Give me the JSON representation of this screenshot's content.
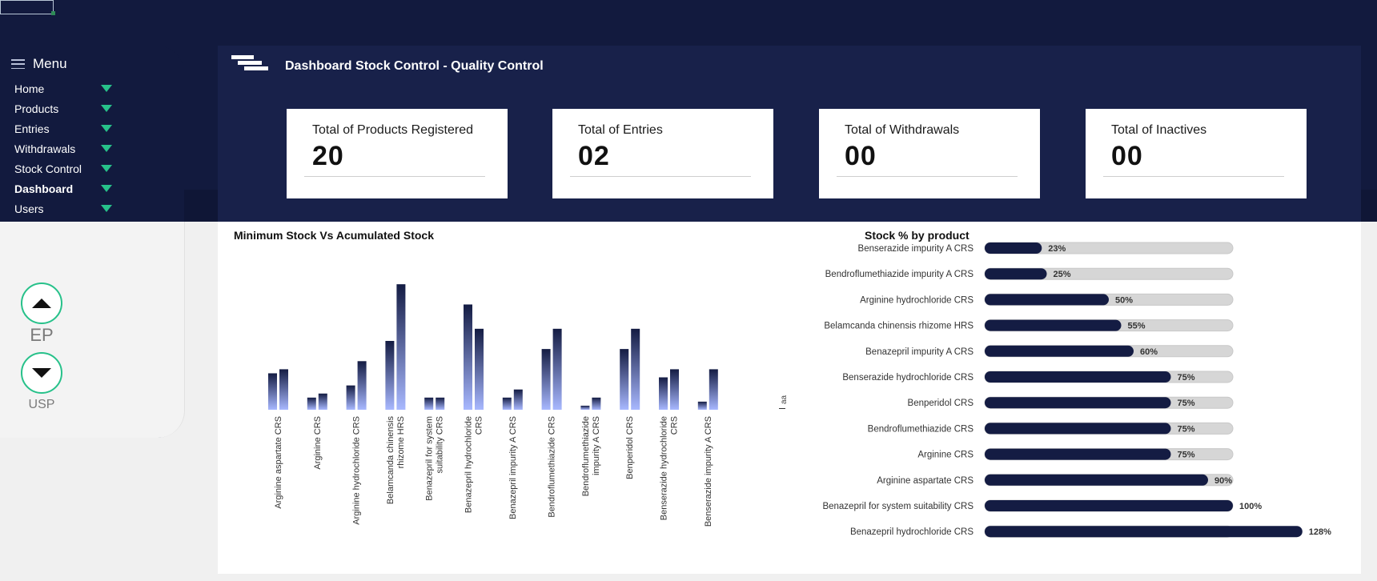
{
  "menu": {
    "title": "Menu",
    "items": [
      {
        "label": "Home",
        "active": false
      },
      {
        "label": "Products",
        "active": false
      },
      {
        "label": "Entries",
        "active": false
      },
      {
        "label": "Withdrawals",
        "active": false
      },
      {
        "label": "Stock Control",
        "active": false
      },
      {
        "label": "Dashboard",
        "active": true
      },
      {
        "label": "Users",
        "active": false
      }
    ]
  },
  "pharmacopeia": {
    "up_label": "EP",
    "down_label": "USP"
  },
  "header": {
    "title": "Dashboard Stock Control - Quality Control"
  },
  "kpis": [
    {
      "label": "Total of Products Registered",
      "value": "20"
    },
    {
      "label": "Total of Entries",
      "value": "02"
    },
    {
      "label": "Total of Withdrawals",
      "value": "00"
    },
    {
      "label": "Total of Inactives",
      "value": "00"
    }
  ],
  "colors": {
    "navy": "#121a3e",
    "accent": "#27c18a",
    "bar_dark": "#141c43",
    "bar_track": "#d6d6d6",
    "bar_light": "#a8b8ff"
  },
  "chart_data": [
    {
      "type": "bar",
      "title": "Minimum Stock Vs Acumulated Stock",
      "categories": [
        "Arginine aspartate CRS",
        "Arginine CRS",
        "Arginine hydrochloride CRS",
        "Belamcanda chinensis rhizome HRS",
        "Benazepril for system suitability CRS",
        "Benazepril hydrochloride CRS",
        "Benazepril impurity A CRS",
        "Bendroflumethiazide CRS",
        "Bendroflumethiazide impurity A CRS",
        "Benperidol CRS",
        "Benserazide hydrochloride CRS",
        "Benserazide impurity A CRS"
      ],
      "series": [
        {
          "values": [
            9,
            3,
            6,
            17,
            3,
            26,
            3,
            15,
            1,
            15,
            8,
            2
          ]
        },
        {
          "values": [
            10,
            4,
            12,
            31,
            3,
            20,
            5,
            20,
            3,
            20,
            10,
            10
          ]
        }
      ],
      "ylim": [
        0,
        34
      ],
      "y_axis_label": "aa"
    },
    {
      "type": "bar",
      "orientation": "horizontal",
      "title": "Stock % by product",
      "categories": [
        "Benserazide impurity A CRS",
        "Bendroflumethiazide impurity A CRS",
        "Arginine hydrochloride CRS",
        "Belamcanda chinensis rhizome HRS",
        "Benazepril impurity A CRS",
        "Benserazide hydrochloride CRS",
        "Benperidol CRS",
        "Bendroflumethiazide CRS",
        "Arginine CRS",
        "Arginine aspartate CRS",
        "Benazepril for system suitability CRS",
        "Benazepril hydrochloride CRS"
      ],
      "values": [
        23,
        25,
        50,
        55,
        60,
        75,
        75,
        75,
        75,
        90,
        100,
        128
      ],
      "value_labels": [
        "23%",
        "25%",
        "50%",
        "55%",
        "60%",
        "75%",
        "75%",
        "75%",
        "75%",
        "90%",
        "100%",
        "128%"
      ],
      "track_max": 100
    }
  ]
}
